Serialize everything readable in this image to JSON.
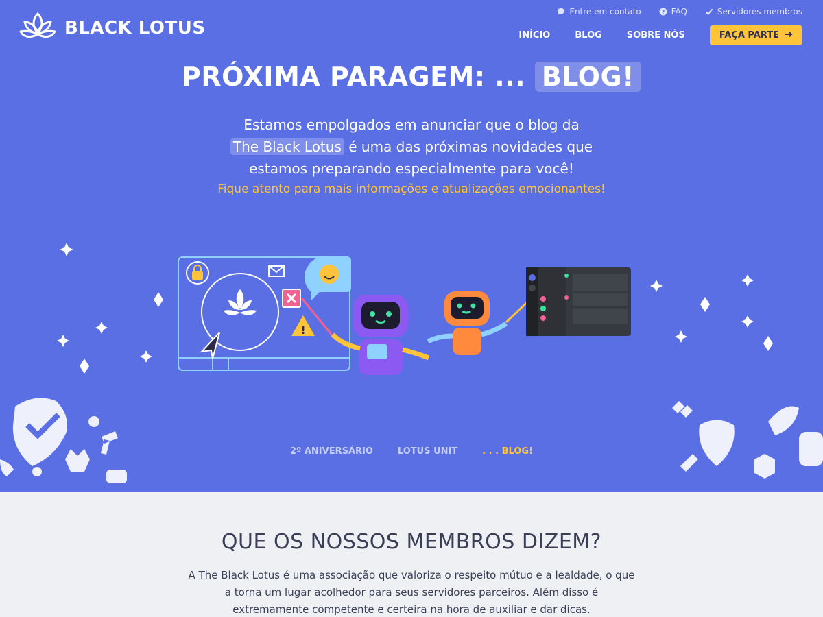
{
  "brand": {
    "name": "BLACK LOTUS"
  },
  "utility_links": [
    {
      "label": "Entre em contato",
      "icon": "chat-icon"
    },
    {
      "label": "FAQ",
      "icon": "question-icon"
    },
    {
      "label": "Servidores membros",
      "icon": "check-icon"
    }
  ],
  "nav": {
    "items": [
      "INÍCIO",
      "BLOG",
      "SOBRE NÓS"
    ],
    "cta_label": "FAÇA PARTE",
    "cta_icon": "arrow-right-icon"
  },
  "hero": {
    "title_prefix": "PRÓXIMA PARAGEM: ...",
    "title_highlight": "BLOG!",
    "desc_line1": "Estamos empolgados em anunciar que o blog da",
    "desc_highlight": "The Black Lotus",
    "desc_line2_rest": " é uma das próximas novidades que",
    "desc_line3": "estamos preparando especialmente para você!",
    "note": "Fique atento para mais informações e atualizações emocionantes!"
  },
  "sub_tabs": [
    {
      "label": "2º ANIVERSÁRIO",
      "active": false
    },
    {
      "label": "LOTUS UNIT",
      "active": false
    },
    {
      "label": ". . . BLOG!",
      "active": true
    }
  ],
  "members": {
    "heading": "QUE OS NOSSOS MEMBROS DIZEM?",
    "text": "A The Black Lotus é uma associação que valoriza o respeito mútuo e a lealdade, o que a torna um lugar acolhedor para seus servidores parceiros. Além disso é extremamente competente e certeira na hora de auxiliar e dar dicas."
  },
  "colors": {
    "hero_bg": "#5a6fe3",
    "accent": "#ffc43a",
    "section_bg": "#eff0f4",
    "text_dark": "#3a3f57"
  }
}
